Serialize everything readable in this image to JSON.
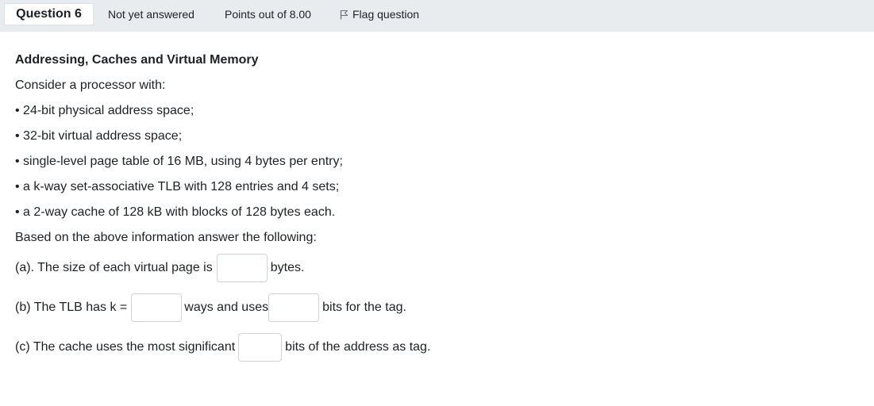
{
  "header": {
    "question_label": "Question 6",
    "status": "Not yet answered",
    "points": "Points out of 8.00",
    "flag_label": "Flag question"
  },
  "question": {
    "title": "Addressing, Caches and Virtual Memory",
    "intro": "Consider a processor with:",
    "bullets": [
      "• 24-bit physical address space;",
      "• 32-bit virtual address space;",
      "• single-level page table of 16 MB, using 4 bytes per entry;",
      "• a k-way set-associative TLB with 128 entries and 4 sets;",
      "• a 2-way cache of 128 kB with blocks of 128 bytes each."
    ],
    "prompt": "Based on the above information answer the following:",
    "part_a": {
      "before": "(a). The size of each virtual page is",
      "after": "bytes.",
      "value": ""
    },
    "part_b": {
      "before": "(b) The TLB has k =",
      "middle": "ways and uses",
      "after": "bits for the tag.",
      "value1": "",
      "value2": ""
    },
    "part_c": {
      "before": "(c)  The cache uses the most significant",
      "after": "bits of the address as tag.",
      "value": ""
    }
  }
}
